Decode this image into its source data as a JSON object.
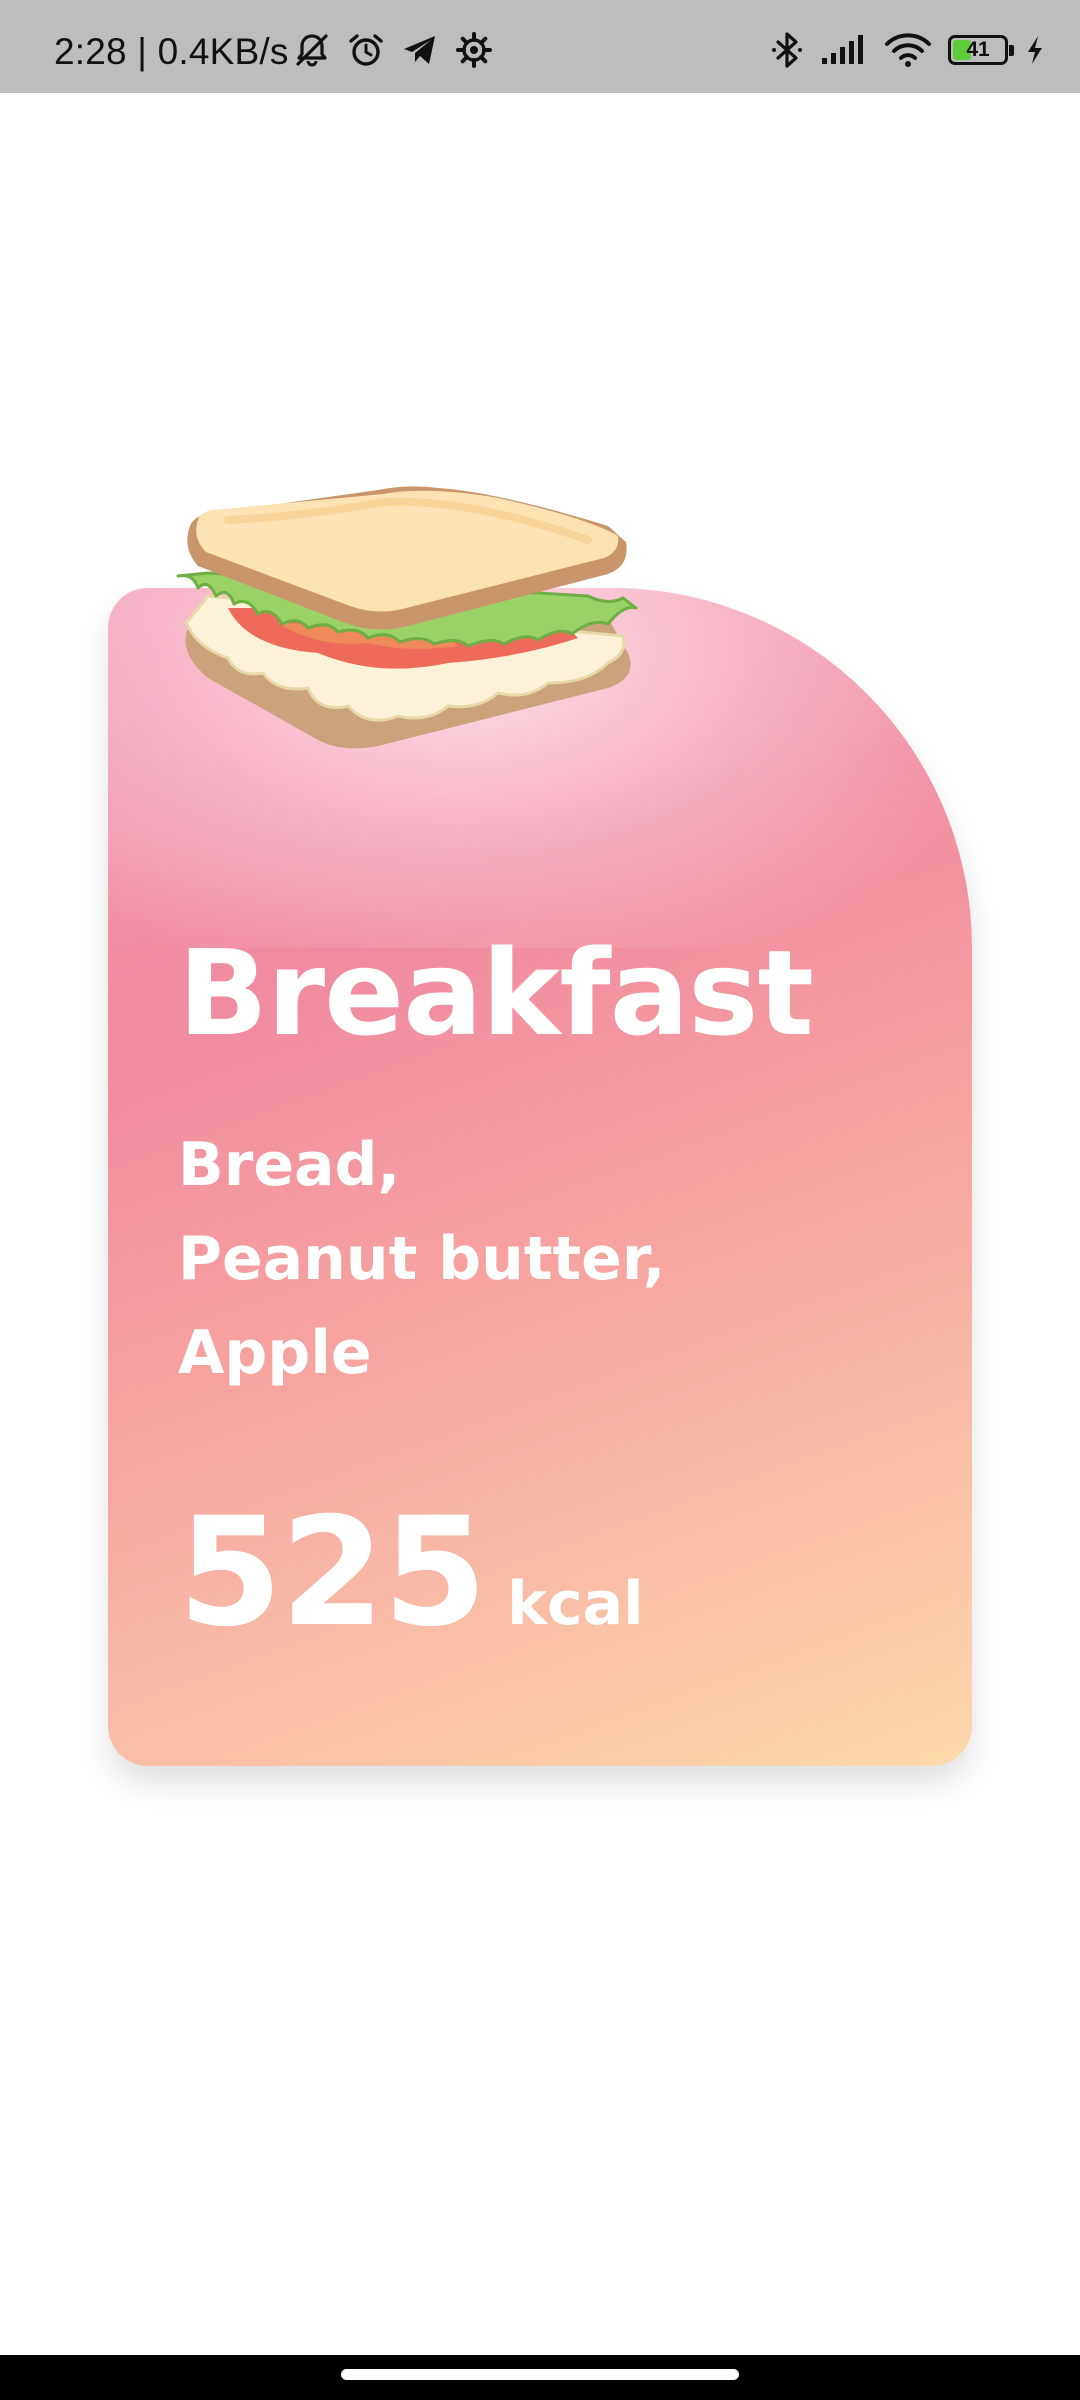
{
  "status_bar": {
    "time_speed": "2:28 | 0.4KB/s",
    "battery_level": "41",
    "battery_fraction": 0.41,
    "icons_left": [
      "silent-icon",
      "alarm-icon",
      "telegram-icon",
      "settings-icon"
    ],
    "icons_right": [
      "bluetooth-icon",
      "signal-icon",
      "wifi-icon",
      "battery-icon",
      "charging-icon"
    ]
  },
  "meal_card": {
    "title": "Breakfast",
    "items": [
      "Bread,",
      "Peanut butter,",
      "Apple"
    ],
    "calories": "525",
    "calories_unit": "kcal",
    "image": "sandwich-illustration",
    "colors": {
      "gradient_start": "#f5a3bb",
      "gradient_mid": "#f08aa0",
      "gradient_end": "#fcd9aa",
      "text": "#ffffff"
    }
  },
  "nav_bar": {
    "home_indicator": "home-indicator"
  }
}
